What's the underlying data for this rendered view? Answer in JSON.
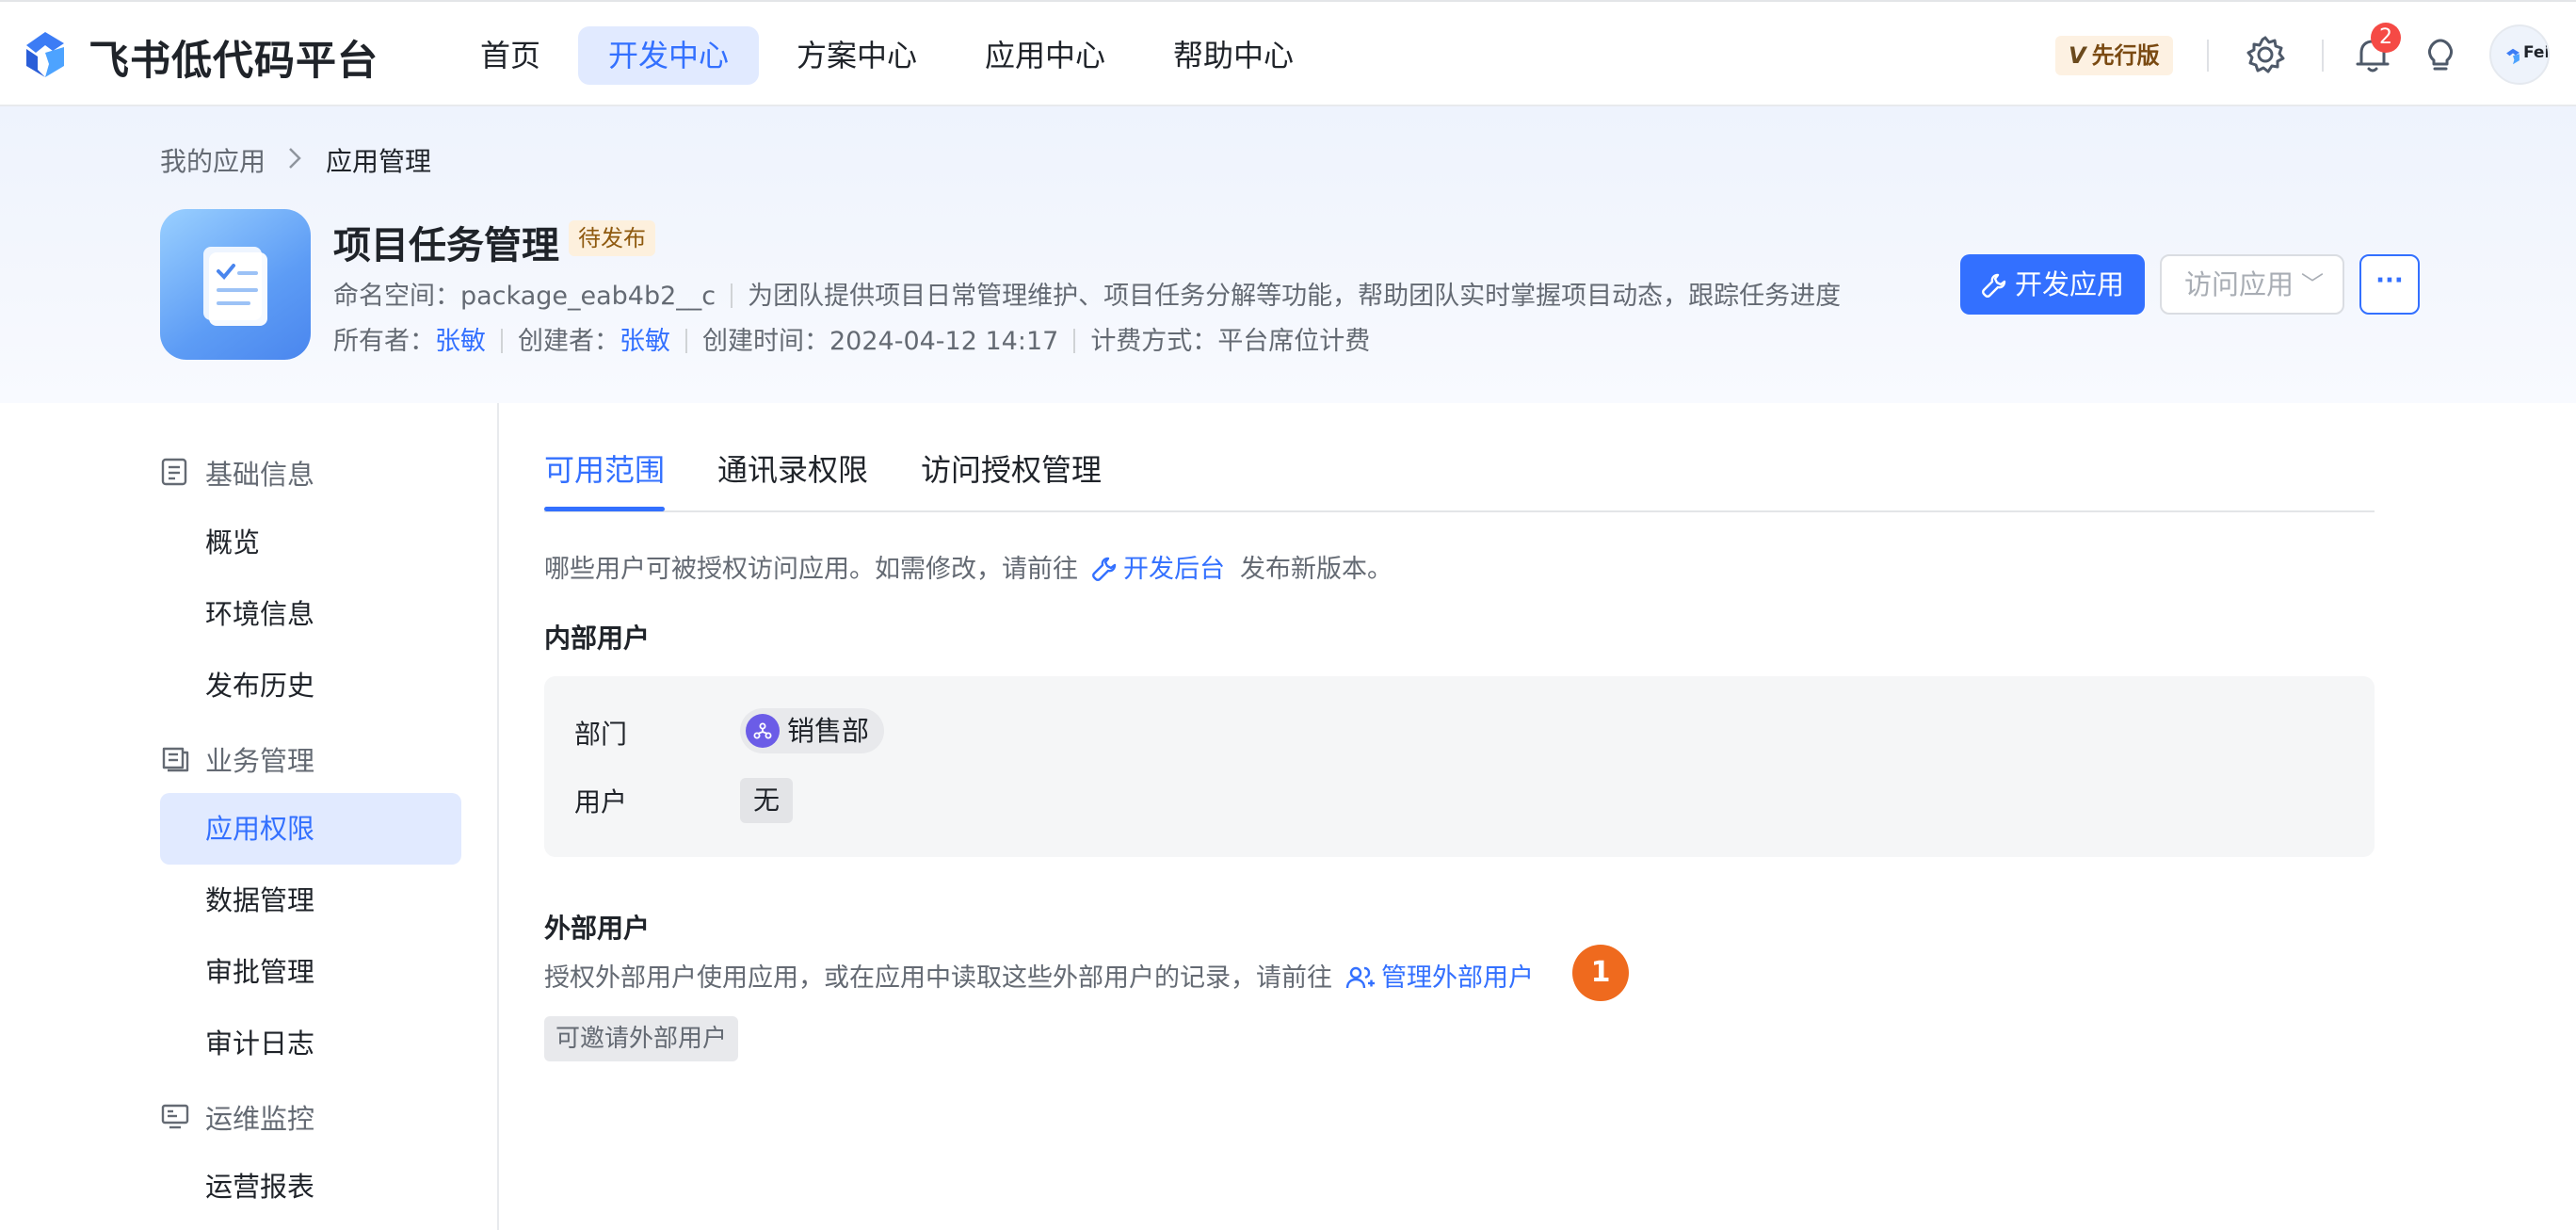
{
  "brand": {
    "name": "飞书低代码平台"
  },
  "nav": [
    {
      "label": "首页"
    },
    {
      "label": "开发中心"
    },
    {
      "label": "方案中心"
    },
    {
      "label": "应用中心"
    },
    {
      "label": "帮助中心"
    }
  ],
  "topbar": {
    "version_badge": "先行版",
    "version_letter": "V",
    "notification_count": "2",
    "avatar_text": "Fei"
  },
  "breadcrumb": {
    "parent": "我的应用",
    "separator": ">",
    "current": "应用管理"
  },
  "app": {
    "title": "项目任务管理",
    "status": "待发布",
    "namespace_label": "命名空间：",
    "namespace": "package_eab4b2__c",
    "description": "为团队提供项目日常管理维护、项目任务分解等功能，帮助团队实时掌握项目动态，跟踪任务进度",
    "owner_label": "所有者：",
    "owner": "张敏",
    "creator_label": "创建者：",
    "creator": "张敏",
    "created_label": "创建时间：",
    "created_time": "2024-04-12 14:17",
    "billing_label": "计费方式：",
    "billing": "平台席位计费"
  },
  "actions": {
    "develop": "开发应用",
    "visit": "访问应用",
    "visit_chevron": "﹀",
    "more": "···"
  },
  "sidebar": {
    "groups": [
      {
        "label": "基础信息",
        "items": [
          "概览",
          "环境信息",
          "发布历史"
        ]
      },
      {
        "label": "业务管理",
        "items": [
          "应用权限",
          "数据管理",
          "审批管理",
          "审计日志"
        ]
      },
      {
        "label": "运维监控",
        "items": [
          "运营报表"
        ]
      }
    ]
  },
  "tabs": [
    {
      "label": "可用范围"
    },
    {
      "label": "通讯录权限"
    },
    {
      "label": "访问授权管理"
    }
  ],
  "scope": {
    "intro_prefix": "哪些用户可被授权访问应用。如需修改，请前往",
    "intro_link": "开发后台",
    "intro_suffix": "发布新版本。",
    "internal_title": "内部用户",
    "dept_label": "部门",
    "dept_value": "销售部",
    "user_label": "用户",
    "user_value": "无",
    "external_title": "外部用户",
    "external_desc_prefix": "授权外部用户使用应用，或在应用中读取这些外部用户的记录，请前往",
    "external_link": "管理外部用户",
    "external_tag": "可邀请外部用户",
    "marker": "1"
  }
}
